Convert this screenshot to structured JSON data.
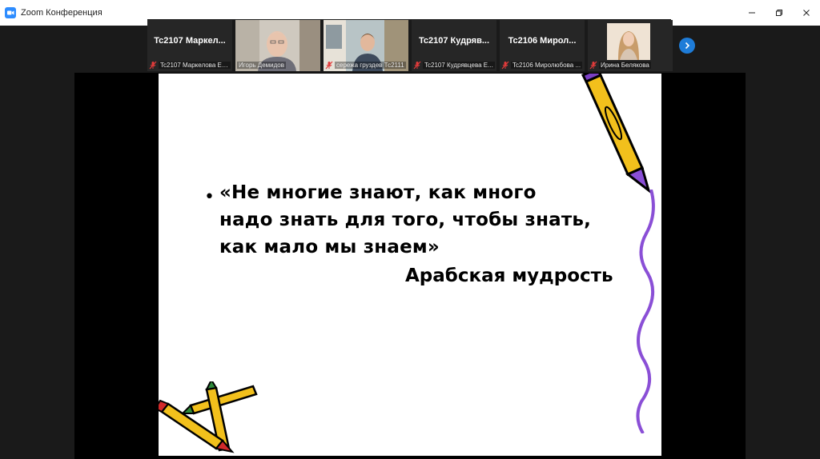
{
  "window": {
    "title": "Zoom Конференция"
  },
  "participants": [
    {
      "display": "Tc2107  Маркел...",
      "name": "Tc2107 Маркелова Ек...",
      "muted": true,
      "video": false
    },
    {
      "display": "",
      "name": "Игорь Демидов",
      "muted": false,
      "video": true,
      "active": true
    },
    {
      "display": "",
      "name": "сережа груздев Тс2111",
      "muted": true,
      "video": true
    },
    {
      "display": "Tc2107  Кудряв...",
      "name": "Tc2107 Кудрявцева Е...",
      "muted": true,
      "video": false
    },
    {
      "display": "Tc2106  Мирол...",
      "name": "Tc2106 Миролюбова ...",
      "muted": true,
      "video": false
    },
    {
      "display": "",
      "name": "Ирина Белякова",
      "muted": true,
      "video": true
    }
  ],
  "slide": {
    "bullet": "•",
    "quote_lines": [
      "«Не многие знают, как много",
      "надо знать для того, чтобы знать,",
      "как мало мы знаем»"
    ],
    "author": "Арабская мудрость"
  },
  "colors": {
    "accent": "#1e7cd8",
    "active_outline": "#7bbf6a",
    "pencil_yellow": "#f2c01c",
    "squiggle_purple": "#8a4fd6"
  }
}
